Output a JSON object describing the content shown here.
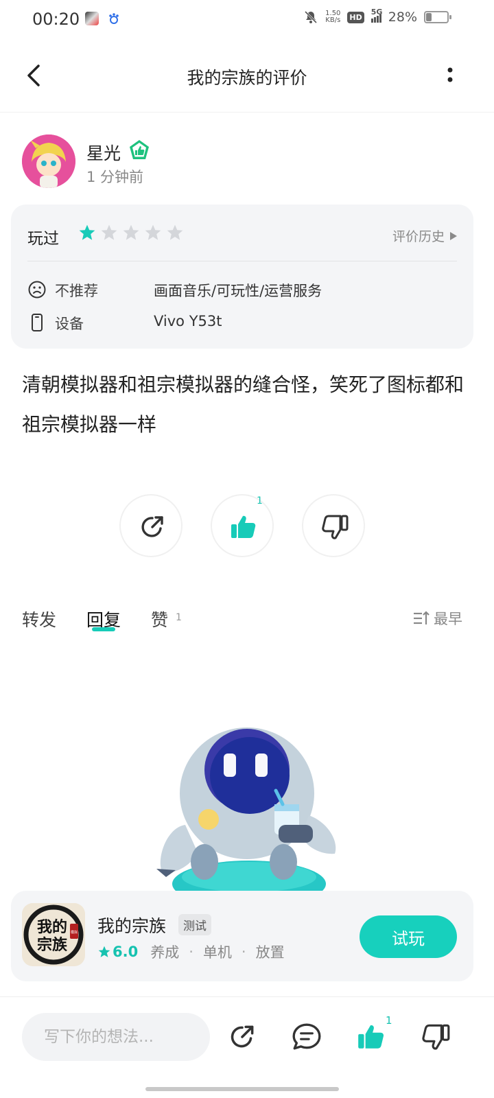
{
  "status_bar": {
    "time": "00:20",
    "net_speed_value": "1.50",
    "net_speed_unit": "KB/s",
    "hd_label": "HD",
    "network": "5G",
    "battery_percent": "28%",
    "battery_level": 0.28,
    "icons": [
      "app-notification-icon",
      "baidu-icon",
      "mute-icon",
      "signal-icon",
      "battery-icon"
    ]
  },
  "nav": {
    "title": "我的宗族的评价",
    "icons": [
      "back-arrow-icon",
      "more-icon"
    ]
  },
  "review": {
    "user_name": "星光",
    "time_ago": "1 分钟前",
    "played_label": "玩过",
    "rating": 1,
    "rating_max": 5,
    "history_label": "评价历史",
    "recommend_label": "不推荐",
    "recommend_value": "画面音乐/可玩性/运营服务",
    "device_label": "设备",
    "device_value": "Vivo Y53t",
    "text": "清朝模拟器和祖宗模拟器的缝合怪，笑死了图标都和祖宗模拟器一样",
    "like_count": "1"
  },
  "tabs": {
    "items": [
      "转发",
      "回复",
      "赞"
    ],
    "active": "回复",
    "like_tab_count": "1",
    "sort_label": "最早"
  },
  "game": {
    "name": "我的宗族",
    "badge": "测试",
    "rating": "6.0",
    "tags": [
      "养成",
      "单机",
      "放置"
    ],
    "icon_text_line1": "我的",
    "icon_text_line2": "宗族",
    "icon_seal": "模拟",
    "try_label": "试玩"
  },
  "bottom_bar": {
    "comment_placeholder": "写下你的想法...",
    "like_count": "1"
  },
  "colors": {
    "accent": "#17cbb8",
    "star_inactive": "#d4d6da",
    "card_bg": "#f4f5f7"
  }
}
